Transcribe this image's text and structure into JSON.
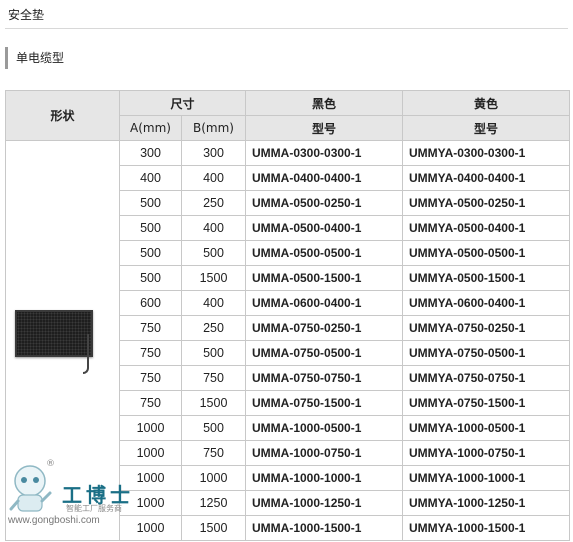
{
  "page_heading": "安全垫",
  "section_title": "单电缆型",
  "table": {
    "headers": {
      "shape": "形状",
      "size": "尺寸",
      "black": "黑色",
      "yellow": "黄色",
      "a_mm": "A(mm)",
      "b_mm": "B(mm)",
      "black_model": "型号",
      "yellow_model": "型号"
    },
    "rows": [
      {
        "a": "300",
        "b": "300",
        "black": "UMMA-0300-0300-1",
        "yellow": "UMMYA-0300-0300-1"
      },
      {
        "a": "400",
        "b": "400",
        "black": "UMMA-0400-0400-1",
        "yellow": "UMMYA-0400-0400-1"
      },
      {
        "a": "500",
        "b": "250",
        "black": "UMMA-0500-0250-1",
        "yellow": "UMMYA-0500-0250-1"
      },
      {
        "a": "500",
        "b": "400",
        "black": "UMMA-0500-0400-1",
        "yellow": "UMMYA-0500-0400-1"
      },
      {
        "a": "500",
        "b": "500",
        "black": "UMMA-0500-0500-1",
        "yellow": "UMMYA-0500-0500-1"
      },
      {
        "a": "500",
        "b": "1500",
        "black": "UMMA-0500-1500-1",
        "yellow": "UMMYA-0500-1500-1"
      },
      {
        "a": "600",
        "b": "400",
        "black": "UMMA-0600-0400-1",
        "yellow": "UMMYA-0600-0400-1"
      },
      {
        "a": "750",
        "b": "250",
        "black": "UMMA-0750-0250-1",
        "yellow": "UMMYA-0750-0250-1"
      },
      {
        "a": "750",
        "b": "500",
        "black": "UMMA-0750-0500-1",
        "yellow": "UMMYA-0750-0500-1"
      },
      {
        "a": "750",
        "b": "750",
        "black": "UMMA-0750-0750-1",
        "yellow": "UMMYA-0750-0750-1"
      },
      {
        "a": "750",
        "b": "1500",
        "black": "UMMA-0750-1500-1",
        "yellow": "UMMYA-0750-1500-1"
      },
      {
        "a": "1000",
        "b": "500",
        "black": "UMMA-1000-0500-1",
        "yellow": "UMMYA-1000-0500-1"
      },
      {
        "a": "1000",
        "b": "750",
        "black": "UMMA-1000-0750-1",
        "yellow": "UMMYA-1000-0750-1"
      },
      {
        "a": "1000",
        "b": "1000",
        "black": "UMMA-1000-1000-1",
        "yellow": "UMMYA-1000-1000-1"
      },
      {
        "a": "1000",
        "b": "1250",
        "black": "UMMA-1000-1250-1",
        "yellow": "UMMYA-1000-1250-1"
      },
      {
        "a": "1000",
        "b": "1500",
        "black": "UMMA-1000-1500-1",
        "yellow": "UMMYA-1000-1500-1"
      }
    ]
  },
  "watermark": {
    "brand": "工博士",
    "registered": "®",
    "tagline": "智能工厂服务商",
    "url": "www.gongboshi.com"
  },
  "colors": {
    "header_bg": "#e6e6e6",
    "border": "#c8c8c8",
    "brand": "#1a6f86"
  }
}
